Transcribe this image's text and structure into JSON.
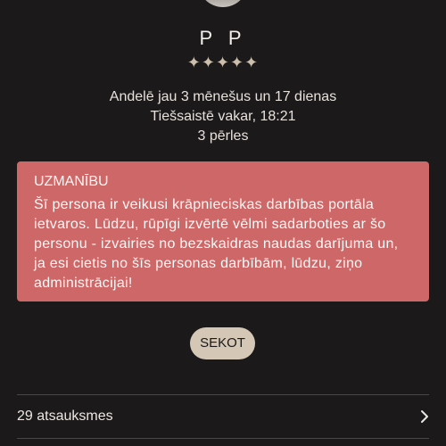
{
  "profile": {
    "name": "P P",
    "stars": "✦✦✦✦✦",
    "member_since": "Andelē jau 3 mēnešus un 17 dienas",
    "last_online": "Tiešsaistē vakar, 18:21",
    "pearls": "3 pērles"
  },
  "alert": {
    "title": "UZMANĪBU",
    "message": "Šī persona ir veikusi krāpnieciskas darbības portāla ietvaros. Lūdzu, rūpīgi izvērtē vēlmi sadarboties ar šo personu - izvairies no bezskaidras naudas darījuma un, ja esi cietis no šīs personas darbībām, lūdzu, ziņo administrācijai!",
    "background_color": "#ce6767"
  },
  "actions": {
    "follow_label": "SEKOT"
  },
  "reviews": {
    "label": "29 atsauksmes",
    "icon": "chevron-right-icon"
  },
  "colors": {
    "background": "#1b1919",
    "button": "#d4c7b6",
    "stars": "#cdbfad"
  }
}
